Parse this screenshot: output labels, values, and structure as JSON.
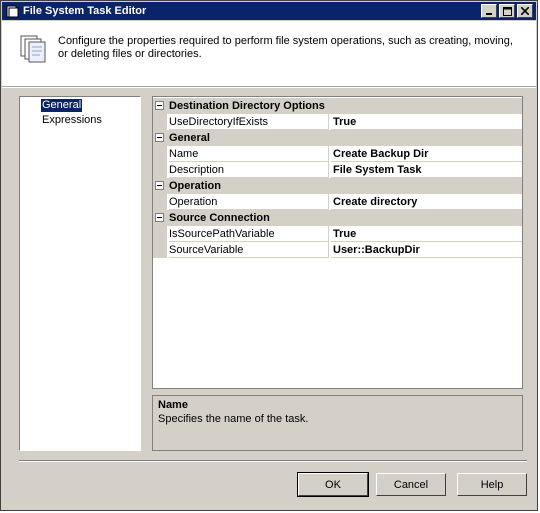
{
  "window": {
    "title": "File System Task Editor"
  },
  "header": {
    "description": "Configure the properties required to perform file system operations, such as creating, moving, or deleting files or directories."
  },
  "nav": {
    "items": [
      {
        "label": "General",
        "selected": true
      },
      {
        "label": "Expressions",
        "selected": false
      }
    ]
  },
  "grid": {
    "categories": [
      {
        "label": "Destination Directory Options",
        "properties": [
          {
            "name": "UseDirectoryIfExists",
            "value": "True"
          }
        ]
      },
      {
        "label": "General",
        "properties": [
          {
            "name": "Name",
            "value": "Create Backup Dir"
          },
          {
            "name": "Description",
            "value": "File System Task"
          }
        ]
      },
      {
        "label": "Operation",
        "properties": [
          {
            "name": "Operation",
            "value": "Create directory"
          }
        ]
      },
      {
        "label": "Source Connection",
        "properties": [
          {
            "name": "IsSourcePathVariable",
            "value": "True"
          },
          {
            "name": "SourceVariable",
            "value": "User::BackupDir"
          }
        ]
      }
    ]
  },
  "info": {
    "title": "Name",
    "description": "Specifies the name of the task."
  },
  "buttons": {
    "ok": "OK",
    "cancel": "Cancel",
    "help": "Help"
  },
  "colors": {
    "titlebar": "#0a246a",
    "dialog": "#d4d0c8",
    "selection": "#0a246a"
  }
}
